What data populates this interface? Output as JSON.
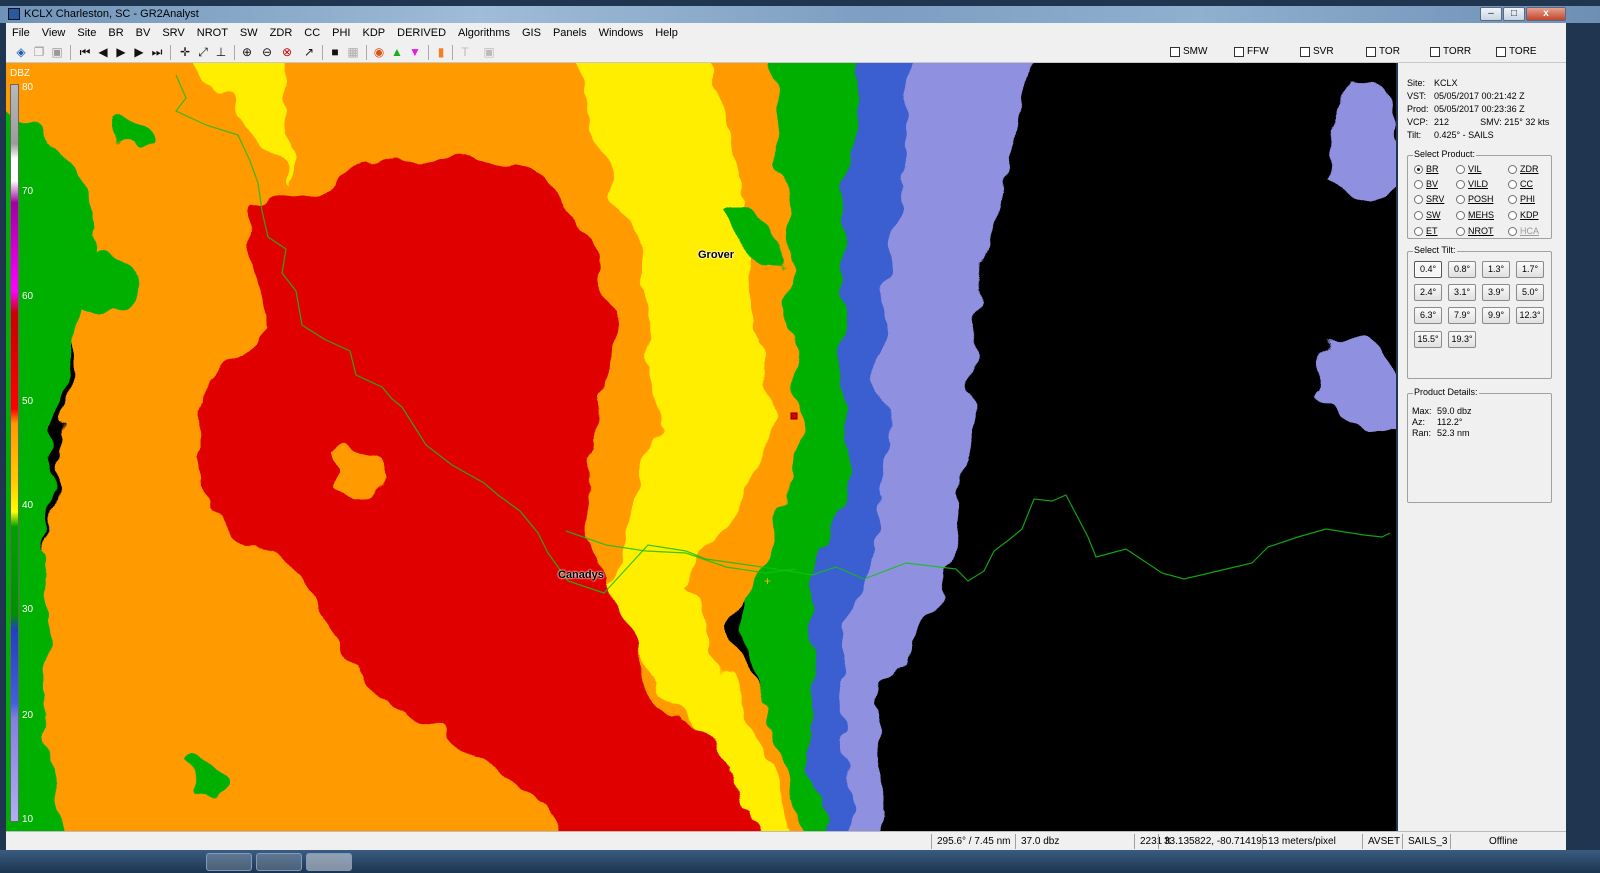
{
  "window": {
    "title": "KCLX Charleston, SC - GR2Analyst",
    "minimize_label": "–",
    "maximize_label": "□",
    "close_label": "x"
  },
  "menu": [
    "File",
    "View",
    "Site",
    "BR",
    "BV",
    "SRV",
    "NROT",
    "SW",
    "ZDR",
    "CC",
    "PHI",
    "KDP",
    "DERIVED",
    "Algorithms",
    "GIS",
    "Panels",
    "Windows",
    "Help"
  ],
  "warnings": [
    "SMW",
    "FFW",
    "SVR",
    "TOR",
    "TORR",
    "TORE"
  ],
  "scale": {
    "unit": "DBZ",
    "ticks": [
      "80",
      "70",
      "60",
      "50",
      "40",
      "30",
      "20",
      "10"
    ]
  },
  "map": {
    "places": [
      "Grover",
      "Canadys"
    ]
  },
  "colors": {
    "red": "#e00000",
    "orange": "#ff9a00",
    "yellow": "#ffee00",
    "green": "#00b000",
    "blue": "#3a5fd0",
    "lavender": "#9090e0",
    "county_line": "#13c013"
  },
  "info": {
    "site": {
      "label": "Site:",
      "value": "KCLX"
    },
    "vst": {
      "label": "VST:",
      "value": "05/05/2017  00:21:42 Z"
    },
    "prod": {
      "label": "Prod:",
      "value": "05/05/2017  00:23:36 Z"
    },
    "vcp": {
      "label": "VCP:",
      "value": "212"
    },
    "smv": {
      "label": "SMV:",
      "value": "215° 32 kts"
    },
    "tilt": {
      "label": "Tilt:",
      "value": "0.425° - SAILS"
    }
  },
  "select_product": {
    "title": "Select Product:",
    "options": [
      "BR",
      "BV",
      "SRV",
      "SW",
      "ET",
      "VIL",
      "VILD",
      "POSH",
      "MEHS",
      "NROT",
      "ZDR",
      "CC",
      "PHI",
      "KDP",
      "HCA"
    ],
    "selected": "BR"
  },
  "select_tilt": {
    "title": "Select Tilt:",
    "options": [
      "0.4°",
      "0.8°",
      "1.3°",
      "1.7°",
      "2.4°",
      "3.1°",
      "3.9°",
      "5.0°",
      "6.3°",
      "7.9°",
      "9.9°",
      "12.3°",
      "15.5°",
      "19.3°"
    ],
    "selected": "0.4°"
  },
  "product_details": {
    "title": "Product Details:",
    "max": {
      "label": "Max:",
      "value": "59.0 dbz"
    },
    "az": {
      "label": "Az:",
      "value": "112.2°"
    },
    "ran": {
      "label": "Ran:",
      "value": "52.3 nm"
    }
  },
  "status": [
    "295.6° / 7.45 nm",
    "37.0 dbz",
    "2231 ft",
    "33.135822, -80.714195",
    "13 meters/pixel",
    "AVSET",
    "SAILS_3",
    "Offline"
  ]
}
